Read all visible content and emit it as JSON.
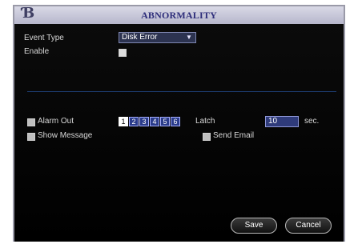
{
  "window": {
    "title": "ABNORMALITY",
    "logo_icon": "dvr-logo-icon"
  },
  "event_type": {
    "label": "Event Type",
    "selected": "Disk Error"
  },
  "enable": {
    "label": "Enable"
  },
  "alarm_out": {
    "label": "Alarm Out",
    "channels": [
      "1",
      "2",
      "3",
      "4",
      "5",
      "6"
    ],
    "selected_index": 0,
    "latch_label": "Latch",
    "latch_value": "10",
    "latch_unit": "sec."
  },
  "notifications": {
    "show_message_label": "Show Message",
    "send_email_label": "Send Email"
  },
  "buttons": {
    "save": "Save",
    "cancel": "Cancel"
  },
  "colors": {
    "title_text": "#2d2d7a",
    "title_bar": "#c8c8da",
    "background": "#000000",
    "field_fill": "#2c3350",
    "accent_blue": "#2a3b8a"
  }
}
